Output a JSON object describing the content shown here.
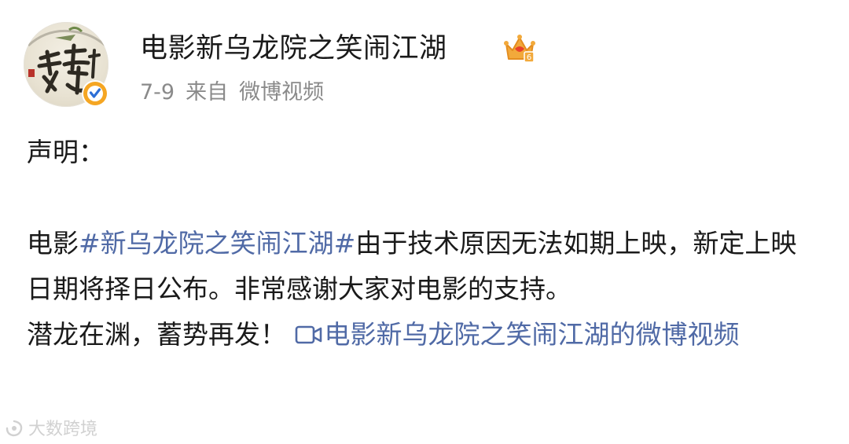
{
  "post": {
    "author_name": "电影新乌龙院之笑闹江湖",
    "crown_icon": "vip-crown-icon",
    "verified_icon": "verified-badge-icon",
    "date": "7-9",
    "source_prefix": "来自",
    "source": "微博视频",
    "heading": "声明：",
    "body_prefix": "电影",
    "hashtag": "#新乌龙院之笑闹江湖#",
    "body_text": "由于技术原因无法如期上映，新定上映日期将择日公布。非常感谢大家对电影的支持。",
    "slogan": "潜龙在渊，蓄势再发！",
    "video_link": "电影新乌龙院之笑闹江湖的微博视频",
    "video_icon": "video-icon"
  },
  "watermark": {
    "text": "大数跨境"
  },
  "colors": {
    "link": "#506aa6",
    "text": "#1a1a1a",
    "meta": "#8a8a8a",
    "verified": "#f5a623"
  }
}
